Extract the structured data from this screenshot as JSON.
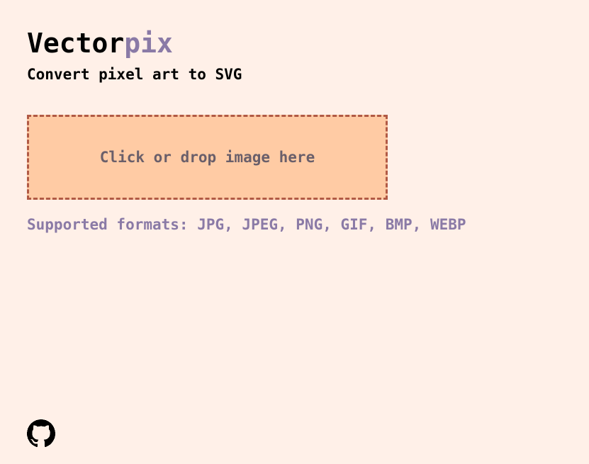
{
  "app": {
    "title_main": "Vector",
    "title_accent": "pix",
    "subtitle": "Convert pixel art to SVG"
  },
  "dropzone": {
    "label": "Click or drop image here"
  },
  "formats": {
    "text": "Supported formats: JPG, JPEG, PNG, GIF, BMP, WEBP"
  },
  "footer": {
    "icon": "github-icon"
  },
  "colors": {
    "background": "#fff0e8",
    "accent": "#8a7aa6",
    "dropzone_fill": "#ffcba4",
    "dropzone_border": "#b15a45",
    "dropzone_text": "#6a5f6a",
    "text": "#000000"
  }
}
